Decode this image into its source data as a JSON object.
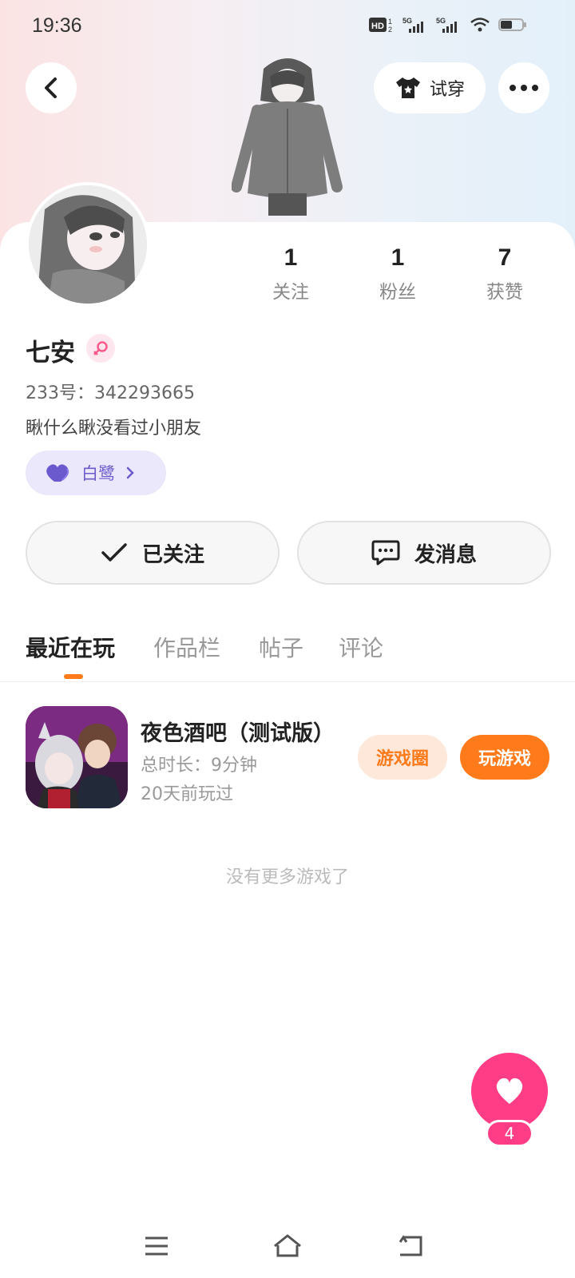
{
  "status_bar": {
    "time": "19:36",
    "icons": [
      "hd-icon",
      "signal-5g-icon",
      "signal-5g-icon",
      "wifi-icon",
      "battery-icon"
    ]
  },
  "header": {
    "tryon_label": "试穿"
  },
  "stats": [
    {
      "value": "1",
      "label": "关注"
    },
    {
      "value": "1",
      "label": "粉丝"
    },
    {
      "value": "7",
      "label": "获赞"
    }
  ],
  "profile": {
    "name": "七安",
    "id_text": "233号：342293665",
    "bio": "瞅什么瞅没看过小朋友",
    "tag_label": "白鹭"
  },
  "actions": {
    "follow_label": "已关注",
    "message_label": "发消息"
  },
  "tabs": [
    {
      "label": "最近在玩"
    },
    {
      "label": "作品栏"
    },
    {
      "label": "帖子"
    },
    {
      "label": "评论"
    }
  ],
  "games": [
    {
      "title": "夜色酒吧（测试版）",
      "playtime": "总时长：9分钟",
      "last_played": "20天前玩过",
      "circle_label": "游戏圈",
      "play_label": "玩游戏"
    }
  ],
  "footer_text": "没有更多游戏了",
  "like": {
    "count": "4"
  },
  "colors": {
    "accent": "#ff7a1a",
    "like": "#ff3d87",
    "tag_bg": "#ece8fb",
    "tag_text": "#6a5acd"
  }
}
